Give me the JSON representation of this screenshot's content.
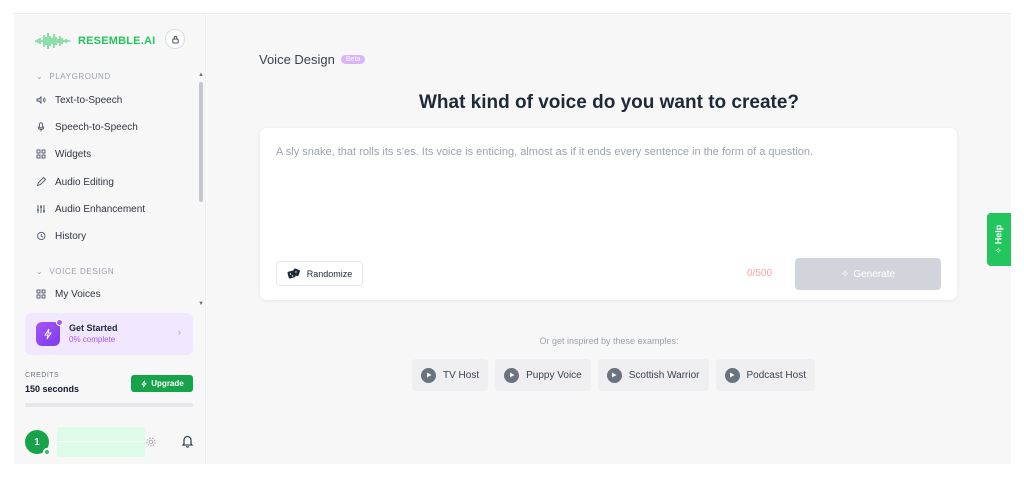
{
  "brand": {
    "name": "RESEMBLE.AI"
  },
  "sidebar": {
    "playground_label": "PLAYGROUND",
    "playground_items": [
      {
        "label": "Text-to-Speech",
        "icon": "speaker-icon"
      },
      {
        "label": "Speech-to-Speech",
        "icon": "microphone-icon"
      },
      {
        "label": "Widgets",
        "icon": "grid-icon"
      },
      {
        "label": "Audio Editing",
        "icon": "pen-icon"
      },
      {
        "label": "Audio Enhancement",
        "icon": "sliders-icon"
      },
      {
        "label": "History",
        "icon": "history-icon"
      }
    ],
    "voice_design_label": "VOICE DESIGN",
    "voice_design_items": [
      {
        "label": "My Voices",
        "icon": "grid-icon"
      }
    ],
    "get_started": {
      "title": "Get Started",
      "progress": "0% complete"
    },
    "credits": {
      "label": "CREDITS",
      "value": "150 seconds",
      "upgrade_label": "Upgrade"
    },
    "user": {
      "avatar_initial": "1"
    }
  },
  "main": {
    "section_title": "Voice Design",
    "beta_badge": "Beta",
    "headline": "What kind of voice do you want to create?",
    "prompt": {
      "placeholder": "A sly snake, that rolls its s'es. Its voice is enticing, almost as if it ends every sentence in the form of a question."
    },
    "randomize_label": "Randomize",
    "counter": "0/500",
    "generate_label": "Generate",
    "inspired_label": "Or get inspired by these examples:",
    "examples": [
      "TV Host",
      "Puppy Voice",
      "Scottish Warrior",
      "Podcast Host"
    ]
  },
  "help_tab": {
    "label": "Help"
  },
  "colors": {
    "brand_green": "#22c55e",
    "accent_purple": "#a855f7",
    "counter_red": "#fca5a5"
  }
}
